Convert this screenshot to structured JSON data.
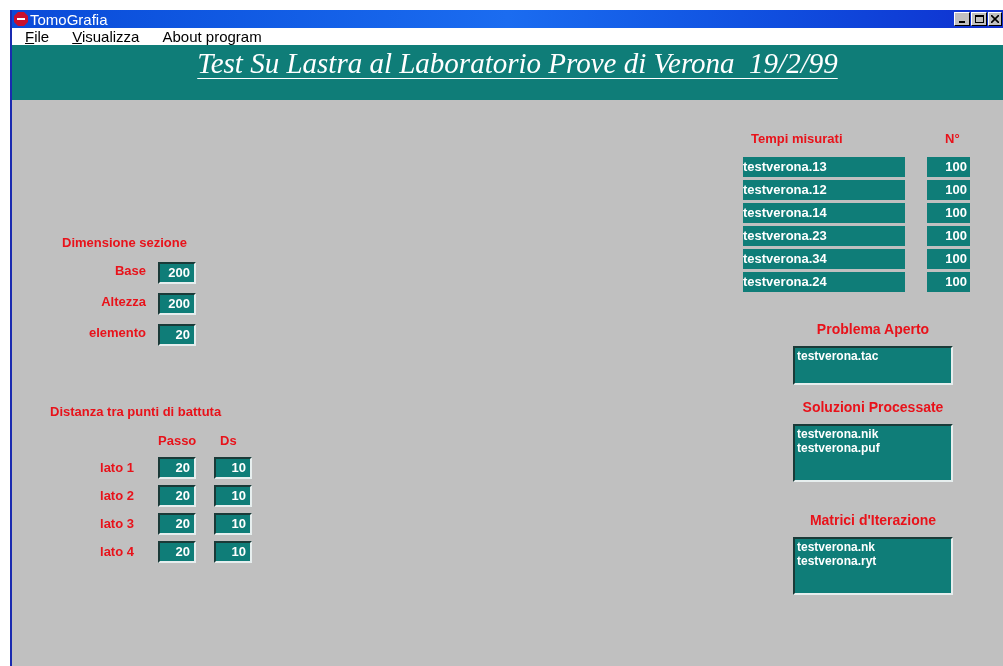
{
  "window": {
    "title": "TomoGrafia"
  },
  "menu": [
    {
      "label": "File",
      "underline_first": true
    },
    {
      "label": "Visualizza",
      "underline_first": true
    },
    {
      "label": "About program",
      "underline_first": false
    }
  ],
  "banner": "Test Su Lastra al Laboratorio Prove di Verona  19/2/99",
  "dimensione": {
    "title": "Dimensione sezione",
    "fields": [
      {
        "label": "Base",
        "value": "200"
      },
      {
        "label": "Altezza",
        "value": "200"
      },
      {
        "label": "elemento",
        "value": "20"
      }
    ]
  },
  "distanza": {
    "title": "Distanza tra punti di battuta",
    "columns": [
      "Passo",
      "Ds"
    ],
    "rows": [
      {
        "label": "lato 1",
        "passo": "20",
        "ds": "10"
      },
      {
        "label": "lato 2",
        "passo": "20",
        "ds": "10"
      },
      {
        "label": "lato 3",
        "passo": "20",
        "ds": "10"
      },
      {
        "label": "lato 4",
        "passo": "20",
        "ds": "10"
      }
    ]
  },
  "tempi": {
    "title": "Tempi misurati",
    "count_title": "N°",
    "rows": [
      {
        "file": "testverona.13",
        "n": "100"
      },
      {
        "file": "testverona.12",
        "n": "100"
      },
      {
        "file": "testverona.14",
        "n": "100"
      },
      {
        "file": "testverona.23",
        "n": "100"
      },
      {
        "file": "testverona.34",
        "n": "100"
      },
      {
        "file": "testverona.24",
        "n": "100"
      }
    ]
  },
  "panels": [
    {
      "title": "Problema Aperto",
      "lines": [
        "testverona.tac"
      ]
    },
    {
      "title": "Soluzioni Processate",
      "lines": [
        "testverona.nik",
        "testverona.puf"
      ]
    },
    {
      "title": "Matrici d'Iterazione",
      "lines": [
        "testverona.nk",
        "testverona.ryt"
      ]
    }
  ]
}
